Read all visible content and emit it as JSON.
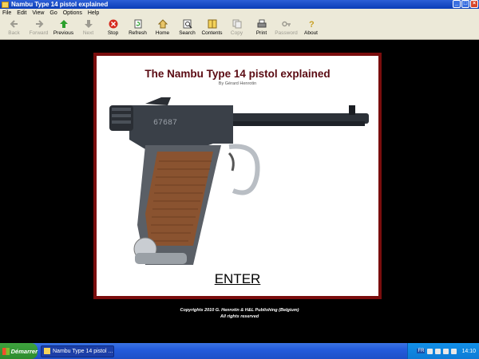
{
  "window": {
    "title": "Nambu Type 14 pistol explained",
    "buttons": [
      "_",
      "□",
      "×"
    ]
  },
  "menu": [
    "File",
    "Edit",
    "View",
    "Go",
    "Options",
    "Help"
  ],
  "toolbar": [
    {
      "label": "Back",
      "icon": "back-arrow-icon",
      "enabled": false
    },
    {
      "label": "Forward",
      "icon": "forward-arrow-icon",
      "enabled": false
    },
    {
      "label": "Previous",
      "icon": "up-arrow-icon",
      "enabled": true
    },
    {
      "label": "Next",
      "icon": "down-arrow-icon",
      "enabled": false
    },
    {
      "label": "Stop",
      "icon": "stop-icon",
      "enabled": true
    },
    {
      "label": "Refresh",
      "icon": "refresh-icon",
      "enabled": true
    },
    {
      "label": "Home",
      "icon": "home-icon",
      "enabled": true
    },
    {
      "label": "Search",
      "icon": "search-icon",
      "enabled": true
    },
    {
      "label": "Contents",
      "icon": "contents-icon",
      "enabled": true
    },
    {
      "label": "Copy",
      "icon": "copy-icon",
      "enabled": false
    },
    {
      "label": "Print",
      "icon": "print-icon",
      "enabled": true
    },
    {
      "label": "Password",
      "icon": "key-icon",
      "enabled": false
    },
    {
      "label": "About",
      "icon": "question-icon",
      "enabled": true
    }
  ],
  "page": {
    "title": "The Nambu Type 14 pistol explained",
    "byline": "By Gérard Henrotin",
    "serial": "67687",
    "enter": "ENTER",
    "copyright": "Copyrights 2010  G. Henrotin & H&L Publishing (Belgium)",
    "rights": "All rights reserved"
  },
  "taskbar": {
    "start": "Démarrer",
    "task": "Nambu Type 14 pistol ...",
    "lang": "FR",
    "clock": "14:10"
  },
  "colors": {
    "frame_border": "#7a0d0d",
    "title": "#5a0a12"
  }
}
